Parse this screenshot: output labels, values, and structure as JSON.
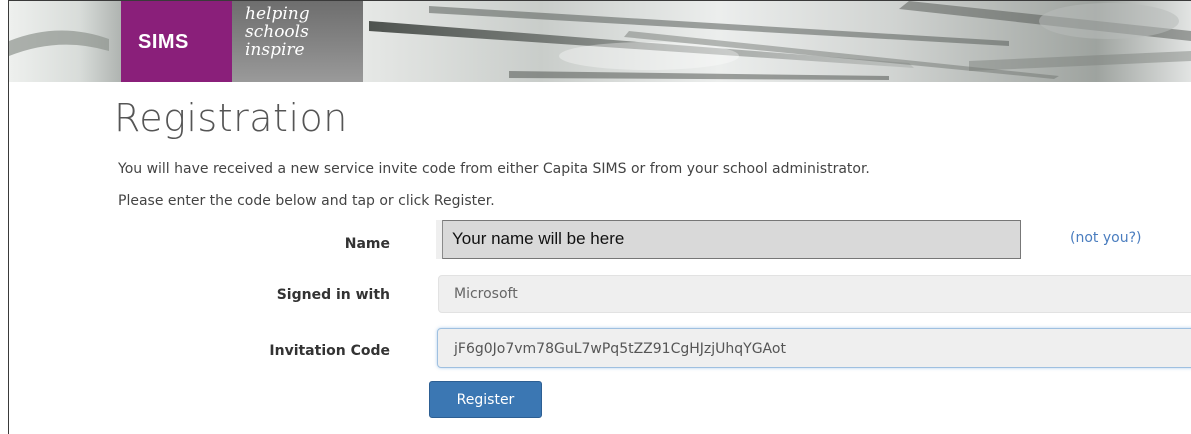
{
  "brand": {
    "logo_text": "SIMS",
    "tagline": [
      "helping",
      "schools",
      "inspire"
    ],
    "logo_color": "#8a1f7a"
  },
  "page": {
    "title": "Registration",
    "intro_line_1": "You will have received a new service invite code from either Capita SIMS or from your school administrator.",
    "intro_line_2": "Please enter the code below and tap or click Register."
  },
  "form": {
    "name_label": "Name",
    "name_value": "Your name will be here",
    "not_you_link": "(not you?)",
    "signed_in_label": "Signed in with",
    "signed_in_value": "Microsoft",
    "invitation_code_label": "Invitation Code",
    "invitation_code_value": "jF6g0Jo7vm78GuL7wPq5tZZ91CgHJzjUhqYGAot",
    "register_button": "Register",
    "button_color": "#3b77b3",
    "link_color": "#4a7dbf"
  }
}
